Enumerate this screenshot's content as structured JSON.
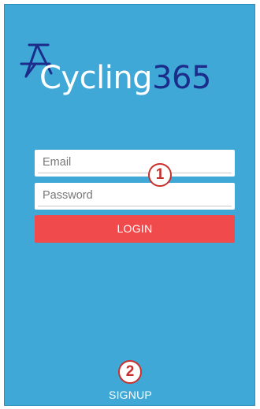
{
  "app": {
    "logo_text_part1": "Cycling",
    "logo_text_part2": "365"
  },
  "login_form": {
    "email_placeholder": "Email",
    "password_placeholder": "Password",
    "login_label": "LOGIN"
  },
  "signup": {
    "label": "SIGNUP"
  },
  "annotations": [
    {
      "label": "1"
    },
    {
      "label": "2"
    }
  ],
  "colors": {
    "background": "#3fa8d6",
    "login_button": "#f14a4c",
    "logo_accent": "#1b2c8a",
    "marker_red": "#c9302c"
  },
  "icons": {
    "logo": "bicycle-logo-icon"
  }
}
